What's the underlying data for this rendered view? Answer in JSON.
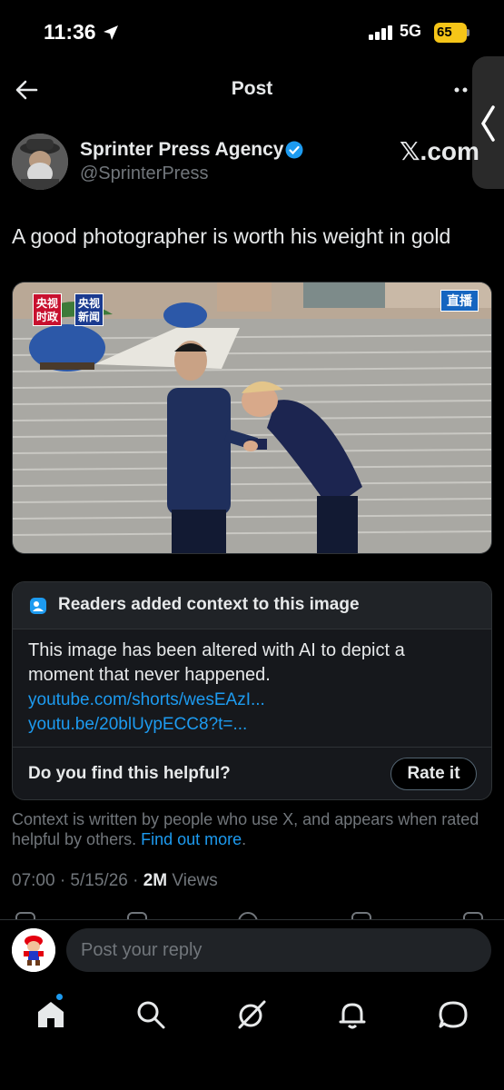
{
  "status_bar": {
    "time": "11:36",
    "network": "5G",
    "battery": "65"
  },
  "nav": {
    "title": "Post"
  },
  "author": {
    "name": "Sprinter Press Agency",
    "handle": "@SprinterPress",
    "verified": true
  },
  "brand_mark": "𝕏.com",
  "post": {
    "text": "A good photographer is worth his weight in gold",
    "image_overlays": {
      "badge_left": "央视 时政",
      "badge_right": "央视 新闻",
      "live_tag": "直播"
    }
  },
  "community_note": {
    "title": "Readers added context to this image",
    "body": "This image has been altered with AI to depict a moment that never happened.",
    "links": [
      "youtube.com/shorts/wesEAzI...",
      "youtu.be/20blUypECC8?t=..."
    ],
    "helpful_question": "Do you find this helpful?",
    "rate_button": "Rate it"
  },
  "context": {
    "text": "Context is written by people who use X, and appears when rated helpful by others.",
    "link": "Find out more",
    "suffix": "."
  },
  "meta": {
    "datetime": "07:00 · 5/15/26 · ",
    "views_count": "2M",
    "views_label": " Views"
  },
  "reply": {
    "placeholder": "Post your reply"
  },
  "colors": {
    "accent": "#1d9bf0",
    "background": "#000000",
    "muted": "#71767b",
    "battery": "#f5c518"
  },
  "icons": {
    "tabs": [
      "home-icon",
      "search-icon",
      "grok-icon",
      "notifications-icon",
      "messages-icon"
    ]
  }
}
